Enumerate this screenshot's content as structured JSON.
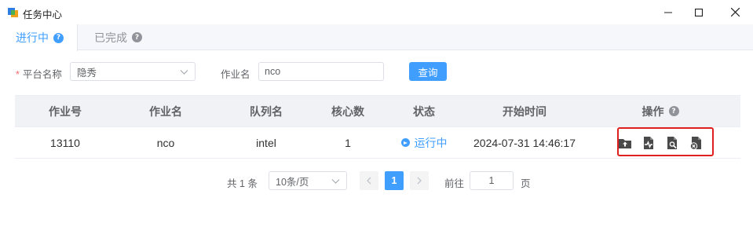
{
  "window": {
    "title": "任务中心",
    "icon": "app-icon"
  },
  "tabs": [
    {
      "label": "进行中",
      "active": true,
      "help_icon": "question-icon"
    },
    {
      "label": "已完成",
      "active": false,
      "help_icon": "question-icon"
    }
  ],
  "filters": {
    "required_mark": "*",
    "platform_label": "平台名称",
    "platform_value": "隐秀",
    "job_name_label": "作业名",
    "job_name_value": "nco",
    "query_button": "查询"
  },
  "table": {
    "columns": [
      "作业号",
      "作业名",
      "队列名",
      "核心数",
      "状态",
      "开始时间",
      "操作"
    ],
    "rows": [
      {
        "job_id": "13110",
        "job_name": "nco",
        "queue": "intel",
        "cores": "1",
        "status": "运行中",
        "start_time": "2024-07-31 14:46:17",
        "actions": [
          "folder-upload-icon",
          "file-monitor-icon",
          "file-search-icon",
          "file-cancel-icon"
        ]
      }
    ]
  },
  "pagination": {
    "total_prefix": "共",
    "total": "1",
    "total_suffix": "条",
    "page_size": "10条/页",
    "current_page": "1",
    "goto_label": "前往",
    "goto_value": "1",
    "goto_suffix": "页"
  },
  "colors": {
    "accent": "#409eff",
    "highlight_frame": "#e02020"
  }
}
